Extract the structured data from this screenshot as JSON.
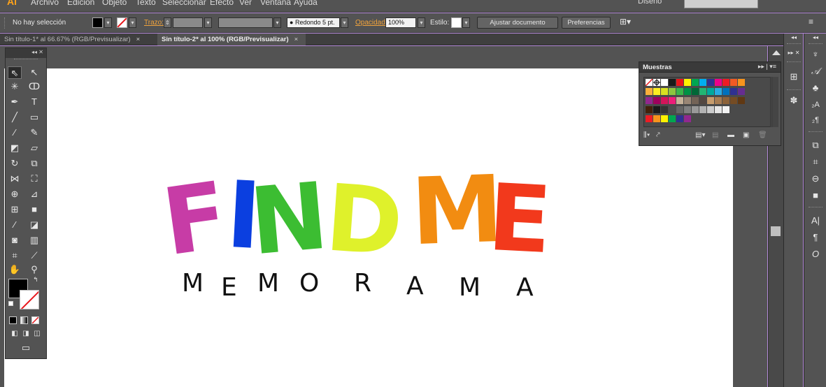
{
  "app": {
    "logo": "Ai",
    "menus": [
      "Archivo",
      "Edición",
      "Objeto",
      "Texto",
      "Seleccionar",
      "Efecto",
      "Ver",
      "Ventana",
      "Ayuda"
    ],
    "workspace": "Diseño"
  },
  "control_bar": {
    "selection_status": "No hay selección",
    "stroke_label": "Trazo:",
    "brush_label": "Redondo 5 pt.",
    "opacity_label": "Opacidad:",
    "opacity_value": "100%",
    "style_label": "Estilo:",
    "fit_document_button": "Ajustar documento",
    "preferences_button": "Preferencias"
  },
  "tabs": [
    {
      "label": "Sin título-1* al 66.67% (RGB/Previsualizar)",
      "close": "×",
      "active": false
    },
    {
      "label": "Sin título-2* al 100% (RGB/Previsualizar)",
      "close": "×",
      "active": true
    }
  ],
  "artwork": {
    "title_letters": [
      {
        "char": "F",
        "color": "#c73ca6"
      },
      {
        "char": "I",
        "color": "#0b3fe0"
      },
      {
        "char": "N",
        "color": "#3cbd32"
      },
      {
        "char": "D",
        "color": "#dff12b"
      },
      {
        "char": "M",
        "color": "#f28c11"
      },
      {
        "char": "E",
        "color": "#f2391c"
      }
    ],
    "subtitle_letters": [
      "M",
      "E",
      "M",
      "O",
      "R",
      "A",
      "M",
      "A"
    ]
  },
  "toolbox": {
    "collapse_label": "◂◂ ✕",
    "tools": [
      "selection-tool",
      "direct-selection-tool",
      "magic-wand-tool",
      "lasso-tool",
      "pen-tool",
      "type-tool",
      "line-tool",
      "rectangle-tool",
      "paintbrush-tool",
      "pencil-tool",
      "blob-brush-tool",
      "eraser-tool",
      "rotate-tool",
      "scale-tool",
      "width-tool",
      "free-transform-tool",
      "shape-builder-tool",
      "perspective-grid-tool",
      "mesh-tool",
      "gradient-tool",
      "eyedropper-tool",
      "blend-tool",
      "symbol-sprayer-tool",
      "column-graph-tool",
      "artboard-tool",
      "slice-tool",
      "hand-tool",
      "zoom-tool"
    ]
  },
  "swatches_panel": {
    "title": "Muestras",
    "menu": "▸▸ | ▾≡",
    "rows": [
      [
        "#ffffff",
        "#ffffff",
        "#ffffff",
        "#1a1a1a",
        "#e8161b",
        "#fff200",
        "#00a651",
        "#00aeef",
        "#2e3192",
        "#ec008c",
        "#ed1c24",
        "#f15a24",
        "#f7941d"
      ],
      [
        "#fbb03b",
        "#fcee21",
        "#d9e021",
        "#8cc63f",
        "#39b54a",
        "#009245",
        "#006837",
        "#22b573",
        "#00a99d",
        "#29abe2",
        "#0071bc",
        "#2e3192",
        "#662d91"
      ],
      [
        "#93278f",
        "#9e005d",
        "#d4145a",
        "#ed1e79",
        "#c7b299",
        "#998675",
        "#736357",
        "#534741",
        "#c69c6d",
        "#a67c52",
        "#8c6239",
        "#754c24",
        "#603813"
      ],
      [
        "#42210b",
        "#1a1a1a",
        "#333333",
        "#4d4d4d",
        "#666666",
        "#808080",
        "#999999",
        "#b3b3b3",
        "#cccccc",
        "#e6e6e6",
        "#f2f2f2",
        "",
        ""
      ],
      [
        "#ed1c24",
        "#f7941d",
        "#fff200",
        "#00a651",
        "#2e3192",
        "#92278f",
        "",
        "",
        "",
        "",
        "",
        "",
        ""
      ]
    ]
  },
  "colors": {
    "ui_dark": "#535353",
    "accent_orange": "#f0a33c"
  }
}
